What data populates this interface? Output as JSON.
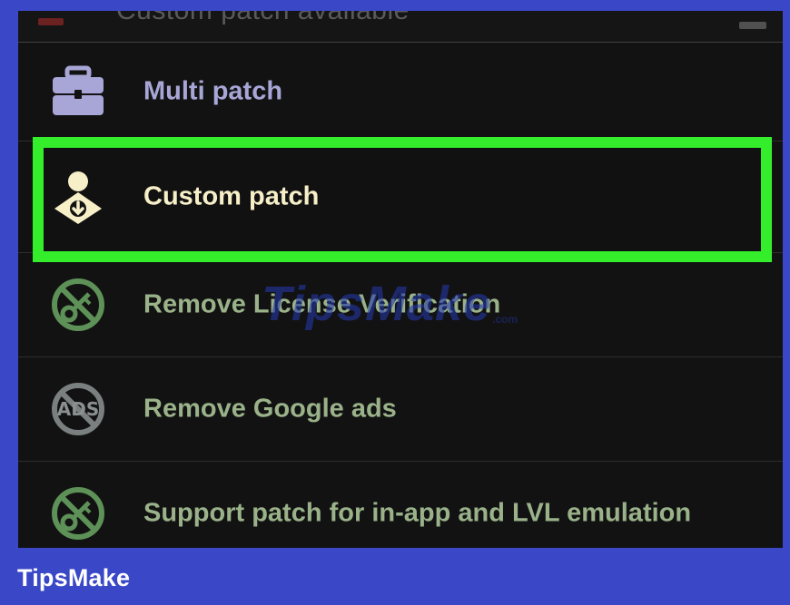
{
  "top_item_partial": "Custom patch available",
  "menu_items": [
    {
      "label": "Multi patch",
      "icon": "briefcase-icon"
    },
    {
      "label": "Custom patch",
      "icon": "user-download-icon"
    },
    {
      "label": "Remove License Verification",
      "icon": "no-key-icon"
    },
    {
      "label": "Remove Google ads",
      "icon": "no-ads-icon"
    },
    {
      "label": "Support patch for in-app and LVL emulation",
      "icon": "no-key-icon"
    }
  ],
  "watermark": "TipsMake",
  "watermark_sub": ".com",
  "footer_brand": "TipsMake",
  "colors": {
    "highlight_border": "#34ee2b",
    "footer_bg": "#3a47c6",
    "multi_label": "#a8a6d6",
    "custom_label": "#f7efc8",
    "green_label": "#9ab28a"
  }
}
